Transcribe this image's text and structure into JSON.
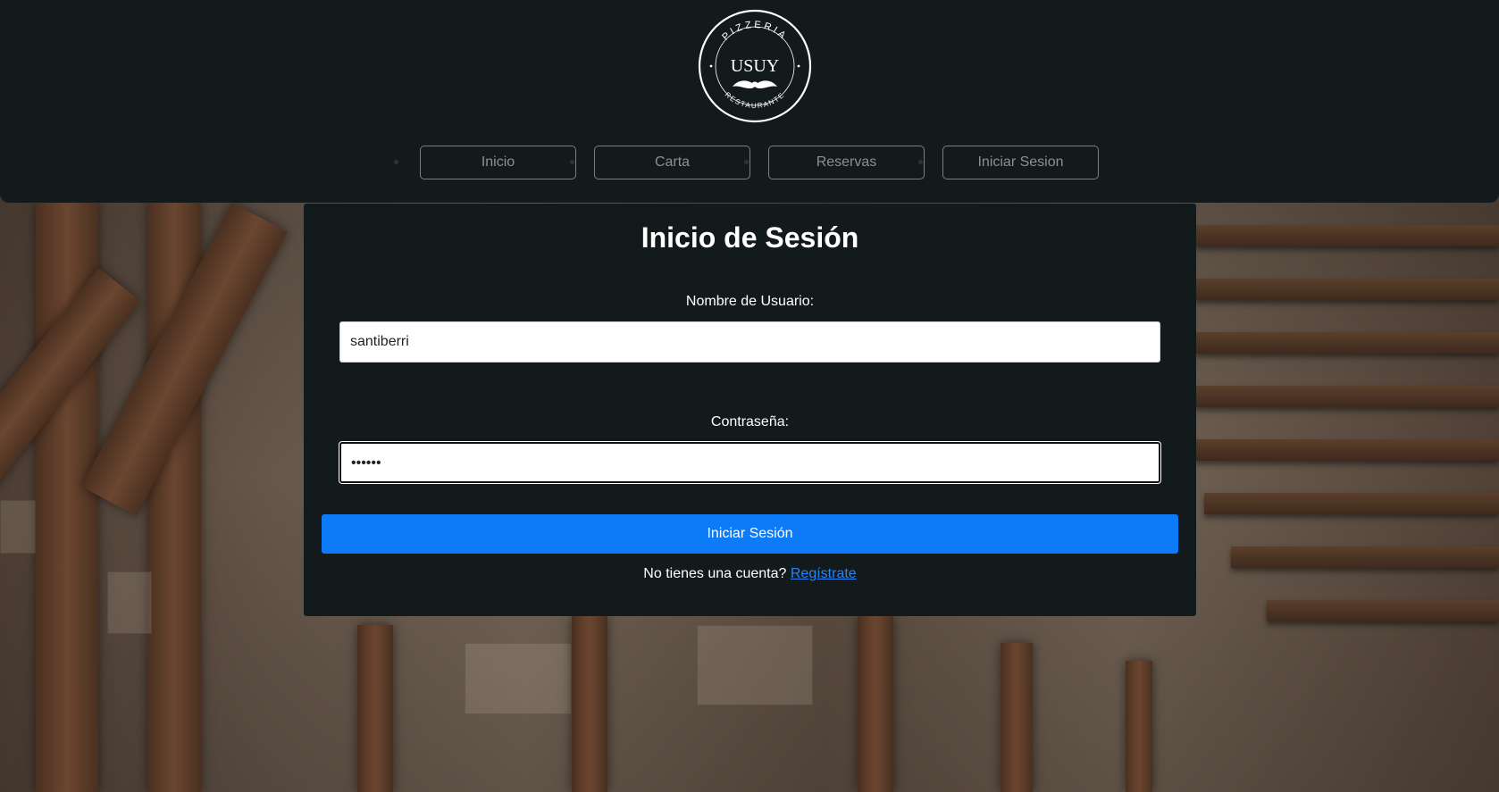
{
  "brand": {
    "top_text": "PIZZERIA",
    "name": "USUY",
    "bottom_text": "RESTAURANTE"
  },
  "nav": {
    "items": [
      {
        "label": "Inicio"
      },
      {
        "label": "Carta"
      },
      {
        "label": "Reservas"
      },
      {
        "label": "Iniciar Sesion"
      }
    ]
  },
  "login": {
    "title": "Inicio de Sesión",
    "username_label": "Nombre de Usuario:",
    "username_value": "santiberri",
    "password_label": "Contraseña:",
    "password_value": "••••••",
    "submit_label": "Iniciar Sesión",
    "register_prompt": "No tienes una cuenta?",
    "register_link": "Regístrate"
  },
  "colors": {
    "header_bg": "#131a1b",
    "card_bg": "#131a1b",
    "primary_button": "#0d7bf8",
    "link": "#2a83f3"
  }
}
